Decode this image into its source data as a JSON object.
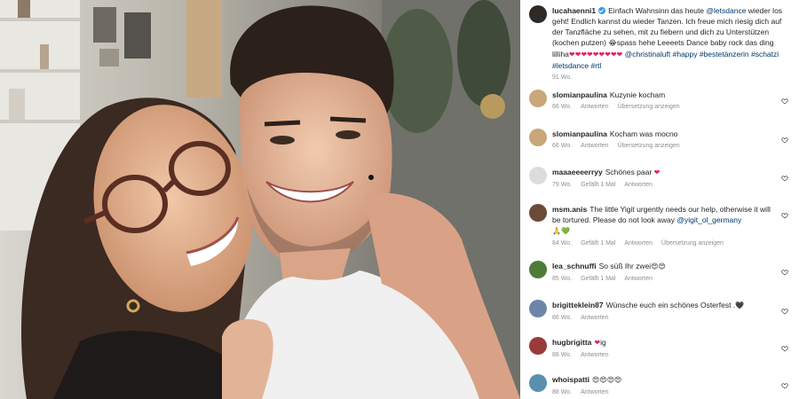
{
  "post": {
    "username": "lucahaenni1",
    "caption_parts": [
      {
        "t": "Einfach Wahnsinn das heute ",
        "link": false
      },
      {
        "t": "@letsdance",
        "link": true
      },
      {
        "t": " wieder los geht! Endlich kannst du wieder Tanzen. Ich freue mich riesig dich auf der Tanzfläche zu sehen, mit zu fiebern und dich zu Unterstützen (kochen putzen) ",
        "link": false
      },
      {
        "t": "😂",
        "link": false,
        "emoji": true
      },
      {
        "t": "spass hehe Leeeets Dance baby rock das ding lilliha",
        "link": false
      },
      {
        "t": "❤❤❤❤❤❤❤❤❤",
        "link": false,
        "emoji": true,
        "red": true
      },
      {
        "t": " ",
        "link": false
      },
      {
        "t": "@christinaluft",
        "link": true
      },
      {
        "t": " ",
        "link": false
      },
      {
        "t": "#happy #bestetänzerin #schatzi #letsdance #rtl",
        "link": true
      }
    ],
    "time": "91 Wo."
  },
  "comments": [
    {
      "user": "slomianpaulina",
      "text": "Kuzynie kocham",
      "time": "66 Wo.",
      "likes": "",
      "reply": "Antworten",
      "translate": "Übersetzung anzeigen",
      "avatar": "#c9a77a"
    },
    {
      "user": "slomianpaulina",
      "text": "Kocham was mocno",
      "time": "66 Wo.",
      "likes": "",
      "reply": "Antworten",
      "translate": "Übersetzung anzeigen",
      "avatar": "#c9a77a"
    },
    {
      "user": "maaaeeeerryy",
      "text": "Schönes paar ",
      "emoji": "❤",
      "emoji_red": true,
      "time": "79 Wo.",
      "likes": "Gefällt 1 Mal",
      "reply": "Antworten",
      "translate": "",
      "avatar": "#dcdcdc"
    },
    {
      "user": "msm.anis",
      "text": "The little Yigit urgently needs our help, otherwise it will be tortured. Please do not look away ",
      "mention": "@yigit_ol_germany",
      "emoji2": "🙏💚",
      "time": "84 Wo.",
      "likes": "Gefällt 1 Mal",
      "reply": "Antworten",
      "translate": "Übersetzung anzeigen",
      "avatar": "#6b4a36"
    },
    {
      "user": "lea_schnuffi",
      "text": "So süß Ihr zwei",
      "emoji": "😍😍",
      "time": "85 Wo.",
      "likes": "Gefällt 1 Mal",
      "reply": "Antworten",
      "translate": "",
      "avatar": "#4f7a3a"
    },
    {
      "user": "brigitteklein87",
      "text": "Wünsche euch ein schönes Osterfest .",
      "emoji": "🖤",
      "time": "86 Wo.",
      "likes": "",
      "reply": "Antworten",
      "translate": "",
      "avatar": "#6d86a8"
    },
    {
      "user": "hugbrigitta",
      "text": "",
      "emoji": "❤",
      "emoji_red": true,
      "after": "ig",
      "time": "88 Wo.",
      "likes": "",
      "reply": "Antworten",
      "translate": "",
      "avatar": "#9a3a3a"
    },
    {
      "user": "whoispatti",
      "text": "",
      "emoji": "😍😍😍😍",
      "time": "88 Wo.",
      "likes": "",
      "reply": "Antworten",
      "translate": "",
      "avatar": "#5a8fb0"
    }
  ],
  "icons": {
    "like": "heart-outline-icon",
    "verified": "verified-badge-icon"
  }
}
